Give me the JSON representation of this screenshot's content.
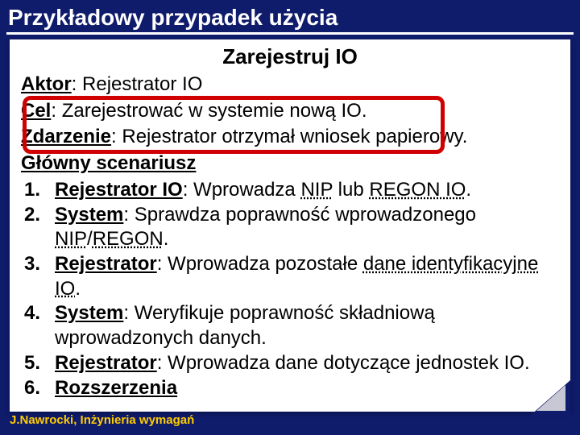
{
  "slide": {
    "title": "Przykładowy przypadek użycia",
    "footer": "J.Nawrocki, Inżynieria wymagań"
  },
  "usecase": {
    "title": "Zarejestruj IO",
    "actor_label": "Aktor",
    "actor_value": ": Rejestrator IO",
    "goal_label": "Cel",
    "goal_value": ": Zarejestrować w systemie nową IO.",
    "event_label": "Zdarzenie",
    "event_value": ": Rejestrator otrzymał wniosek papierowy.",
    "scenario_label": "Główny scenariusz",
    "steps": [
      {
        "num": "1.",
        "actor": "Rejestrator IO",
        "sep": ": Wprowadza ",
        "t1": "NIP",
        "mid": " lub ",
        "t2": "REGON IO",
        "tail": "."
      },
      {
        "num": "2.",
        "actor": "System",
        "sep": ": Sprawdza poprawność wprowadzonego ",
        "t1": "NIP",
        "mid": "/",
        "t2": "REGON",
        "tail": "."
      },
      {
        "num": "3.",
        "actor": "Rejestrator",
        "sep": ": Wprowadza pozostałe ",
        "t1": "dane identyfikacyjne IO",
        "mid": "",
        "t2": "",
        "tail": "."
      },
      {
        "num": "4.",
        "actor": "System",
        "sep": ": Weryfikuje poprawność składniową wprowadzonych danych.",
        "t1": "",
        "mid": "",
        "t2": "",
        "tail": ""
      },
      {
        "num": "5.",
        "actor": "Rejestrator",
        "sep": ": Wprowadza dane dotyczące jednostek IO.",
        "t1": "",
        "mid": "",
        "t2": "",
        "tail": ""
      }
    ],
    "ext_num": "6.",
    "ext_label": "Rozszerzenia"
  }
}
